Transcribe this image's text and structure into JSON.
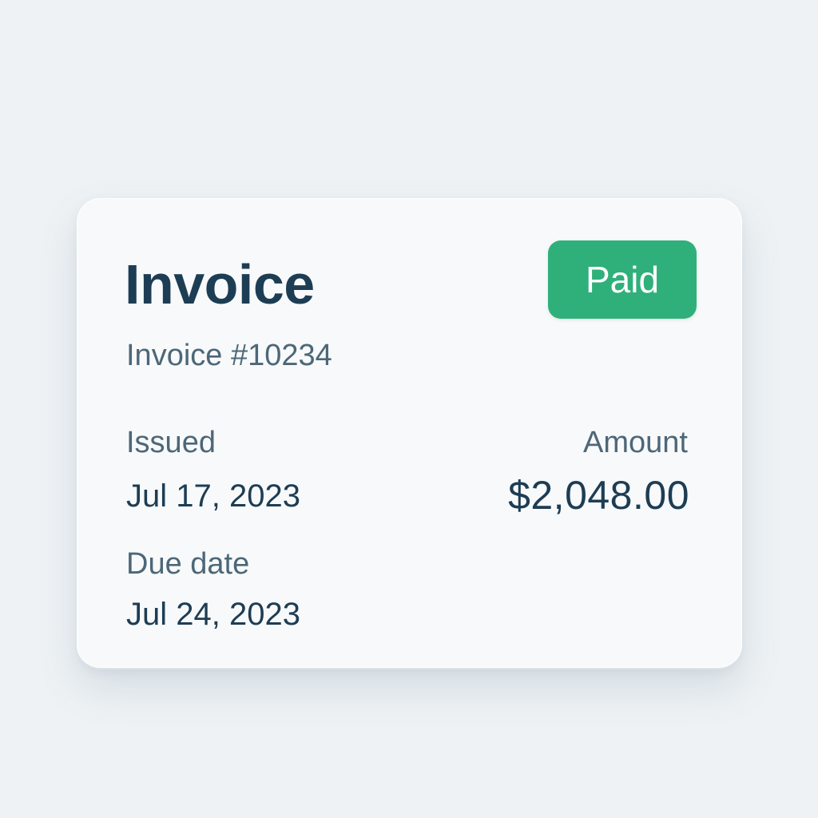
{
  "invoice": {
    "title": "Invoice",
    "number": "Invoice #10234",
    "status": "Paid",
    "issued_label": "Issued",
    "issued_date": "Jul 17, 2023",
    "due_label": "Due date",
    "due_date": "Jul 24, 2023",
    "amount_label": "Amount",
    "amount_value": "$2,048.00"
  },
  "colors": {
    "background": "#eef2f5",
    "card": "#f8f9fa",
    "primary_text": "#1d3d54",
    "secondary_text": "#4c6778",
    "status_paid": "#2fb07b"
  }
}
